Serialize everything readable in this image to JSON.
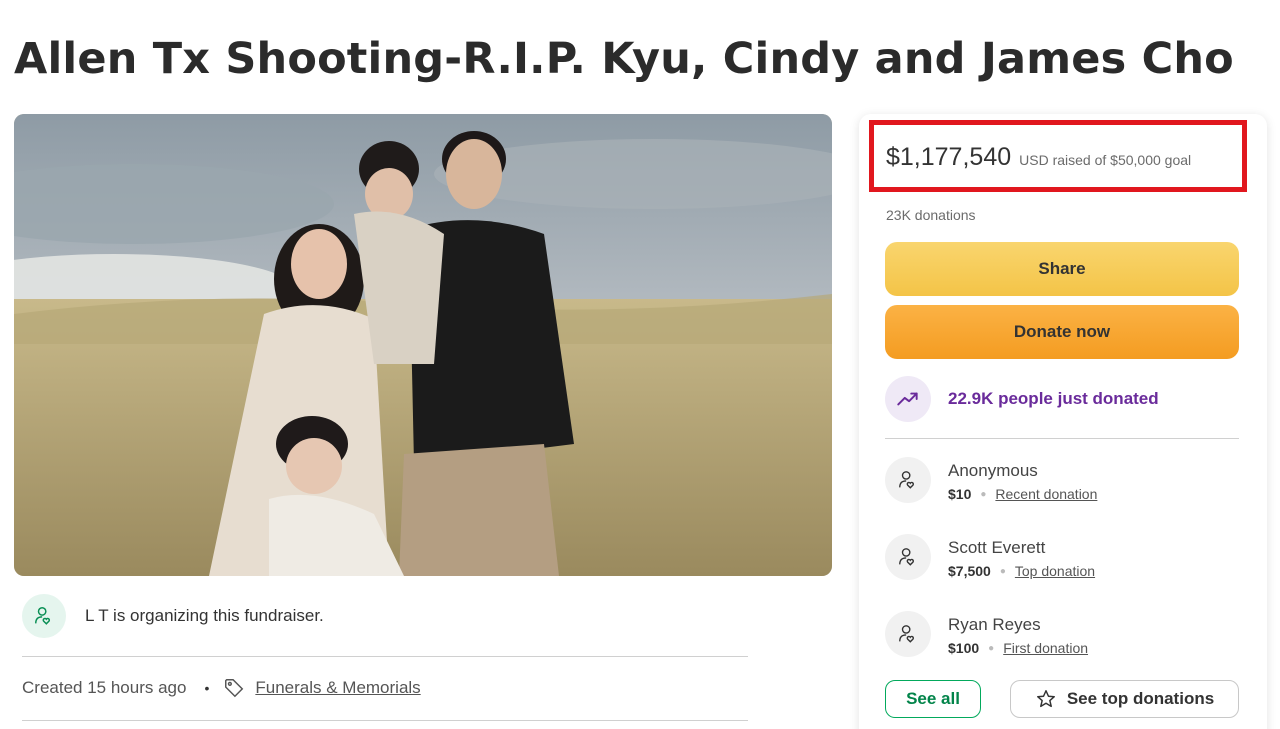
{
  "title": "Allen Tx Shooting-R.I.P. Kyu, Cindy and James Cho",
  "organizer": {
    "text": "L T is organizing this fundraiser.",
    "icon": "person-heart-icon"
  },
  "meta": {
    "created": "Created 15 hours ago",
    "separator": "•",
    "category": "Funerals & Memorials",
    "category_icon": "tag-icon"
  },
  "campaign": {
    "raised_amount": "$1,177,540",
    "raised_rest": "USD raised of $50,000 goal",
    "donation_count": "23K donations",
    "share_label": "Share",
    "donate_label": "Donate now",
    "trend_text": "22.9K people just donated",
    "trend_icon": "trending-up-icon"
  },
  "donors": [
    {
      "name": "Anonymous",
      "amount": "$10",
      "label": "Recent donation"
    },
    {
      "name": "Scott Everett",
      "amount": "$7,500",
      "label": "Top donation"
    },
    {
      "name": "Ryan Reyes",
      "amount": "$100",
      "label": "First donation"
    }
  ],
  "buttons": {
    "see_all": "See all",
    "see_top": "See top donations"
  },
  "colors": {
    "highlight_border": "#e1171e",
    "share_button": "#f6cb56",
    "donate_button": "#f6a42e",
    "trend_text": "#6a2b9b",
    "see_all_green": "#02a95c"
  }
}
